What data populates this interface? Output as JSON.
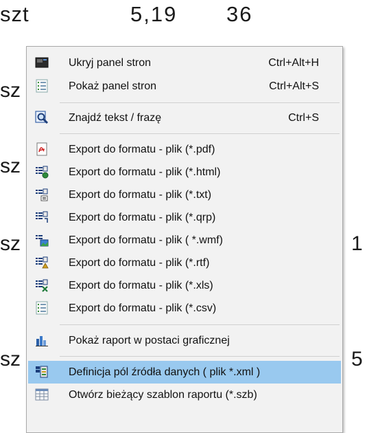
{
  "background": {
    "top_row": [
      "szt",
      "5,19",
      "36"
    ],
    "left_fragments": [
      "sz",
      "sz",
      "sz",
      "sz"
    ],
    "right_fragments": [
      "1",
      "5"
    ]
  },
  "menu": {
    "items": [
      {
        "label": "Ukryj panel  stron",
        "shortcut": "Ctrl+Alt+H",
        "icon": "hide-panel-icon"
      },
      {
        "label": "Pokaż panel stron",
        "shortcut": "Ctrl+Alt+S",
        "icon": "show-panel-icon"
      },
      {
        "label": "Znajdź  tekst / frazę",
        "shortcut": "Ctrl+S",
        "icon": "find-icon"
      },
      {
        "label": "Export do formatu - plik (*.pdf)",
        "shortcut": "",
        "icon": "pdf-icon"
      },
      {
        "label": "Export do formatu - plik (*.html)",
        "shortcut": "",
        "icon": "html-export-icon"
      },
      {
        "label": "Export do formatu - plik  (*.txt)",
        "shortcut": "",
        "icon": "txt-export-icon"
      },
      {
        "label": "Export do formatu - plik (*.qrp)",
        "shortcut": "",
        "icon": "qrp-export-icon"
      },
      {
        "label": "Export do formatu - plik ( *.wmf)",
        "shortcut": "",
        "icon": "wmf-export-icon"
      },
      {
        "label": "Export do formatu - plik (*.rtf)",
        "shortcut": "",
        "icon": "rtf-export-icon"
      },
      {
        "label": "Export do formatu - plik (*.xls)",
        "shortcut": "",
        "icon": "xls-export-icon"
      },
      {
        "label": "Export do formatu - plik  (*.csv)",
        "shortcut": "",
        "icon": "csv-export-icon"
      },
      {
        "label": "Pokaż raport w postaci graficznej",
        "shortcut": "",
        "icon": "bar-chart-icon"
      },
      {
        "label": "Definicja pól źródła danych ( plik *.xml )",
        "shortcut": "",
        "icon": "data-source-icon",
        "selected": true
      },
      {
        "label": "Otwórz bieżący szablon raportu (*.szb)",
        "shortcut": "",
        "icon": "template-icon"
      }
    ]
  },
  "colors": {
    "selection": "#99c9ef",
    "menu_bg": "#f2f2f2"
  }
}
